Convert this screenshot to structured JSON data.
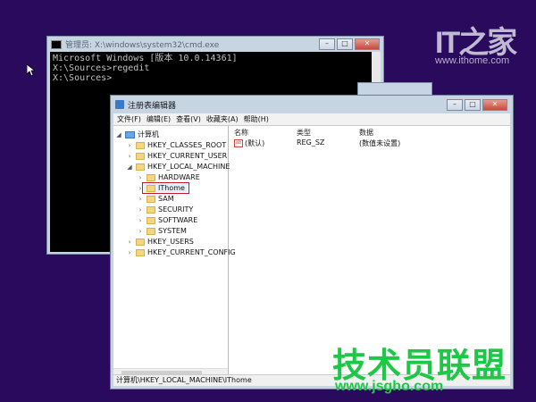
{
  "watermark": {
    "logo": "IT之家",
    "url": "www.ithome.com",
    "site_cn": "技术员联盟",
    "site_url": "www.jsgho.com"
  },
  "cmd": {
    "title": "管理员: X:\\windows\\system32\\cmd.exe",
    "lines": [
      "Microsoft Windows [版本 10.0.14361]",
      "",
      "X:\\Sources>regedit",
      "",
      "X:\\Sources>"
    ]
  },
  "regedit": {
    "title": "注册表编辑器",
    "menu": [
      "文件(F)",
      "编辑(E)",
      "查看(V)",
      "收藏夹(A)",
      "帮助(H)"
    ],
    "tree": {
      "root": "计算机",
      "hkcr": "HKEY_CLASSES_ROOT",
      "hkcu": "HKEY_CURRENT_USER",
      "hklm": "HKEY_LOCAL_MACHINE",
      "hardware": "HARDWARE",
      "ithome": "IThome",
      "sam": "SAM",
      "security": "SECURITY",
      "software": "SOFTWARE",
      "system": "SYSTEM",
      "hku": "HKEY_USERS",
      "hkcc": "HKEY_CURRENT_CONFIG"
    },
    "columns": {
      "name": "名称",
      "type": "类型",
      "data": "数据"
    },
    "value_row": {
      "icon": "ab",
      "name": "(默认)",
      "type": "REG_SZ",
      "data": "(数值未设置)"
    },
    "status": "计算机\\HKEY_LOCAL_MACHINE\\IThome"
  }
}
